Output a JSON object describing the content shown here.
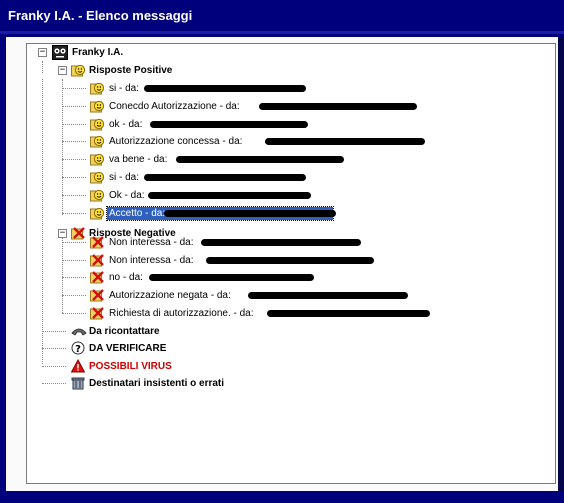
{
  "window": {
    "title": "Franky I.A. - Elenco messaggi"
  },
  "tree": {
    "root": {
      "label": "Franky I.A.",
      "expander": "−"
    },
    "positive": {
      "label": "Risposte Positive",
      "expander": "−",
      "items": [
        {
          "label": "si - da:"
        },
        {
          "label": "Conecdo Autorizzazione - da:"
        },
        {
          "label": "ok - da:"
        },
        {
          "label": "Autorizzazione concessa - da:"
        },
        {
          "label": "va bene - da:"
        },
        {
          "label": "si - da:"
        },
        {
          "label": "Ok - da:"
        },
        {
          "label": "Accetto - da:"
        }
      ]
    },
    "negative": {
      "label": "Risposte Negative",
      "expander": "−",
      "items": [
        {
          "label": "Non interessa - da:"
        },
        {
          "label": "Non interessa - da:"
        },
        {
          "label": "no - da:"
        },
        {
          "label": "Autorizzazione negata - da:"
        },
        {
          "label": "Richiesta di autorizzazione. - da:"
        }
      ]
    },
    "others": [
      {
        "label": "Da ricontattare",
        "icon": "phone-icon"
      },
      {
        "label": "DA VERIFICARE",
        "icon": "question-icon"
      },
      {
        "label": "POSSIBILI VIRUS",
        "icon": "warning-icon",
        "color": "#cc0000"
      },
      {
        "label": "Destinatari insistenti o errati",
        "icon": "trash-icon"
      }
    ]
  },
  "colors": {
    "title_bar": "#00007d",
    "selection": "#2e5fbf",
    "virus_text": "#cc0000"
  }
}
